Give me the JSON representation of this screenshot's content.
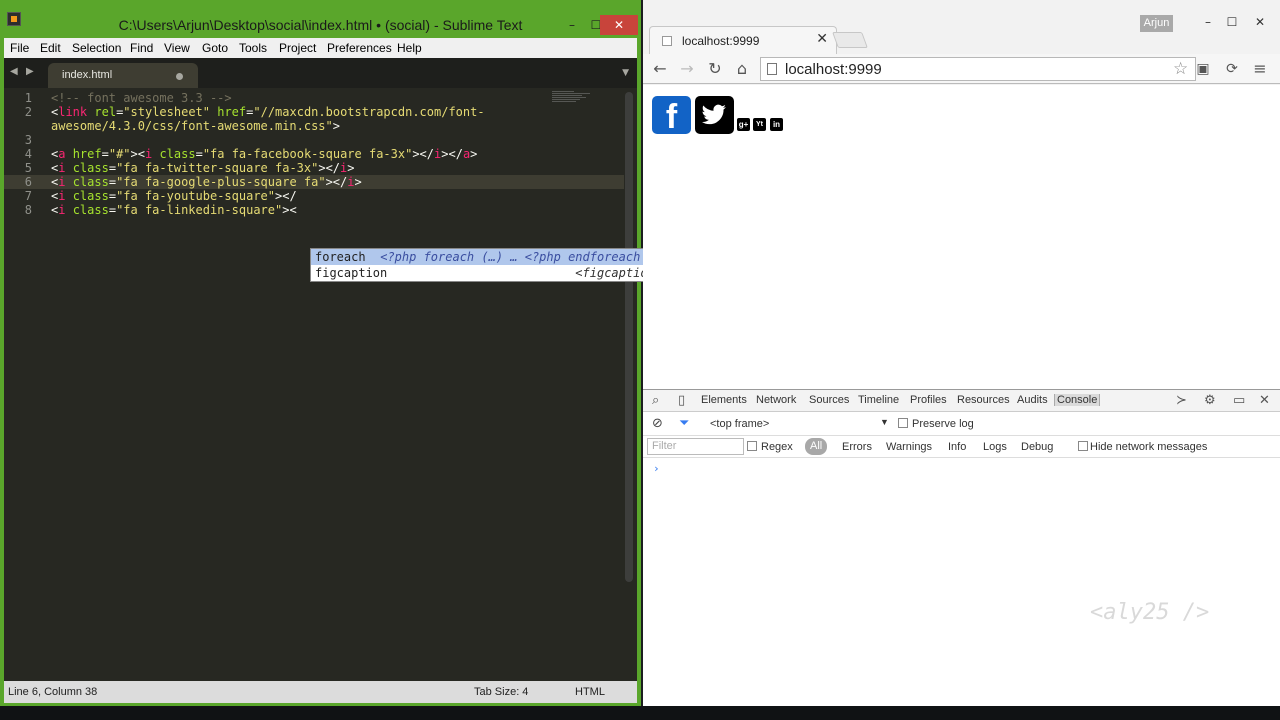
{
  "sublime": {
    "title": "C:\\Users\\Arjun\\Desktop\\social\\index.html • (social) - Sublime Text",
    "window_controls": {
      "minimize": "–",
      "maximize": "☐",
      "close": "✕"
    },
    "menu": [
      "File",
      "Edit",
      "Selection",
      "Find",
      "View",
      "Goto",
      "Tools",
      "Project",
      "Preferences",
      "Help"
    ],
    "tab": {
      "label": "index.html",
      "nav_left": "◀",
      "nav_right": "▶",
      "overflow": "▼"
    },
    "line_numbers": [
      "1",
      "2",
      "3",
      "4",
      "5",
      "6",
      "7",
      "8"
    ],
    "code": {
      "l1": {
        "comment": "<!-- font awesome 3.3 -->"
      },
      "l2a": {
        "lt": "<",
        "tag": "link",
        "sp1": " ",
        "attr1": "rel",
        "eq1": "=",
        "val1": "\"stylesheet\"",
        "sp2": " ",
        "attr2": "href",
        "eq2": "=",
        "val2": "\"//maxcdn.bootstrapcdn.com/font-"
      },
      "l2b": {
        "val": "awesome/4.3.0/css/font-awesome.min.css\"",
        "gt": ">"
      },
      "l4": {
        "lt1": "<",
        "tag1": "a",
        "sp1": " ",
        "attr1": "href",
        "eq1": "=",
        "val1": "\"#\"",
        "gt1": "><",
        "tag2": "i",
        "sp2": " ",
        "attr2": "class",
        "eq2": "=",
        "val2": "\"fa fa-facebook-square fa-3x\"",
        "close": "></",
        "tag3": "i",
        "close2": "></",
        "tag4": "a",
        "gt": ">"
      },
      "l5": {
        "lt": "<",
        "tag": "i",
        "sp": " ",
        "attr": "class",
        "eq": "=",
        "val": "\"fa fa-twitter-square fa-3x\"",
        "close": "></",
        "tag2": "i",
        "gt": ">"
      },
      "l6": {
        "lt": "<",
        "tag": "i",
        "sp": " ",
        "attr": "class",
        "eq": "=",
        "val": "\"fa fa-google-plus-square fa\"",
        "close": "></",
        "tag2": "i",
        "gt": ">"
      },
      "l7": {
        "lt": "<",
        "tag": "i",
        "sp": " ",
        "attr": "class",
        "eq": "=",
        "val": "\"fa fa-youtube-square\"",
        "close": "></",
        "tag2": ""
      },
      "l8": {
        "lt": "<",
        "tag": "i",
        "sp": " ",
        "attr": "class",
        "eq": "=",
        "val": "\"fa fa-linkedin-square\"",
        "close": "><"
      }
    },
    "autocomplete": [
      {
        "trigger": "foreach",
        "hint": "<?php foreach (…) … <?php endforeach ?>"
      },
      {
        "trigger": "figcaption",
        "hint": "<figcaption>"
      }
    ],
    "status": {
      "position": "Line 6, Column 38",
      "tab_size": "Tab Size: 4",
      "syntax": "HTML"
    }
  },
  "chrome": {
    "tab_title": "localhost:9999",
    "tab_close": "✕",
    "user": "Arjun",
    "window_controls": {
      "minimize": "–",
      "maximize": "☐",
      "close": "✕"
    },
    "toolbar": {
      "back": "←",
      "forward": "→",
      "reload": "↻",
      "home": "⌂",
      "url": "localhost:9999",
      "star": "☆",
      "cast": "▣",
      "extension": "⟳",
      "menu": "≡"
    },
    "page_icons": {
      "facebook": "f",
      "twitter": "t",
      "google_plus": "g+",
      "youtube": "Yt",
      "linkedin": "in"
    },
    "devtools": {
      "tabs": [
        "Elements",
        "Network",
        "Sources",
        "Timeline",
        "Profiles",
        "Resources",
        "Audits",
        "Console"
      ],
      "active_tab": "Console",
      "frame": "<top frame>",
      "preserve_log": "Preserve log",
      "filter_placeholder": "Filter",
      "regex": "Regex",
      "levels": [
        "All",
        "Errors",
        "Warnings",
        "Info",
        "Logs",
        "Debug"
      ],
      "hide_network": "Hide network messages",
      "prompt": "›"
    },
    "watermark": "<aly25 />"
  },
  "colors": {
    "sublime_frame": "#5aa62b",
    "editor_bg": "#272822",
    "tag": "#f92672",
    "attr": "#a6e22e",
    "string": "#e6db74",
    "comment": "#75715e",
    "facebook_blue": "#1263c6"
  }
}
